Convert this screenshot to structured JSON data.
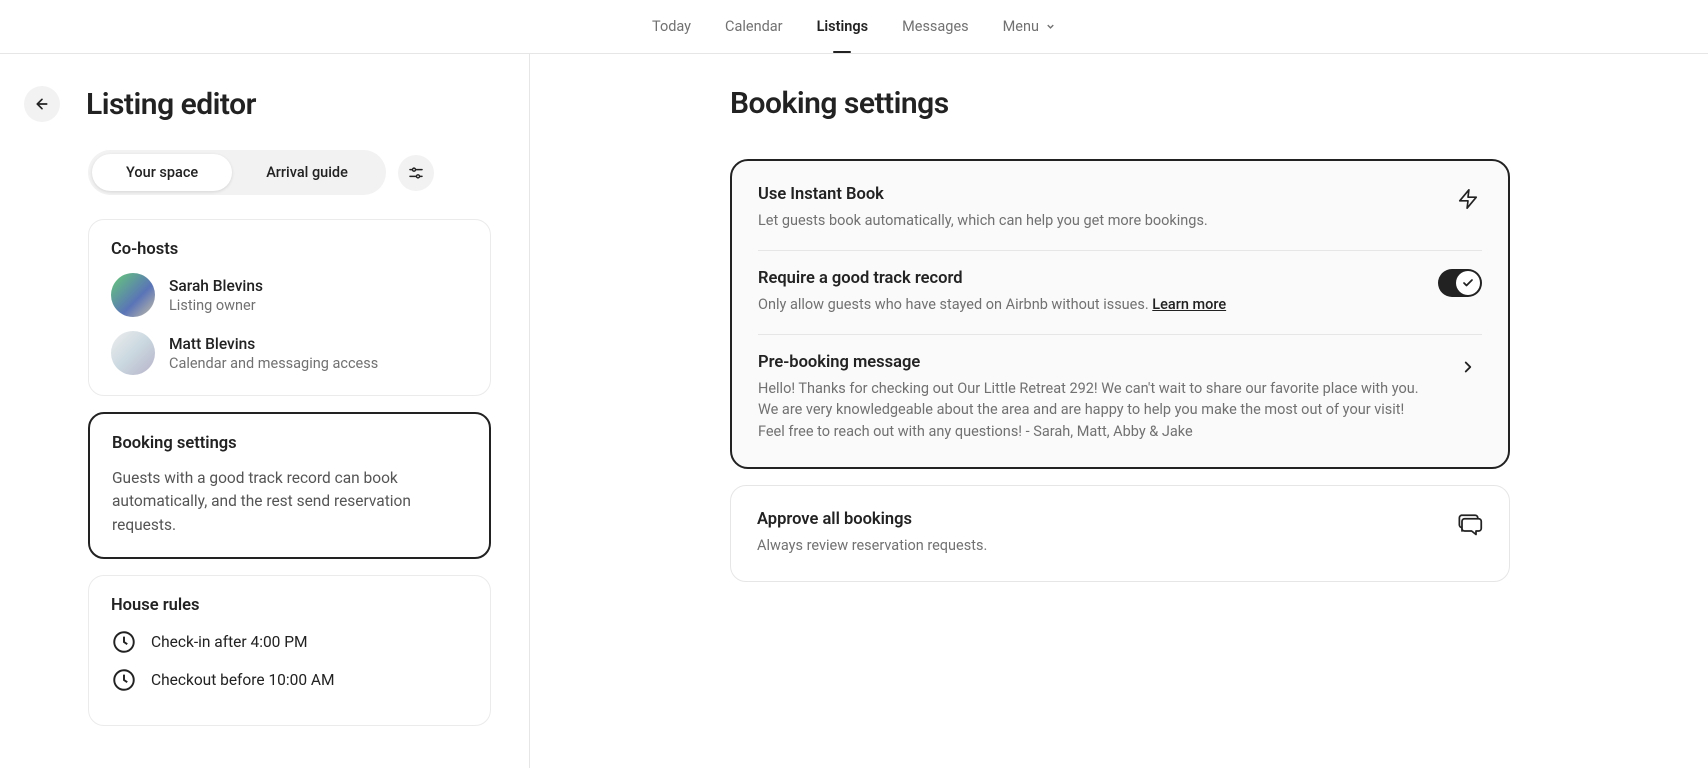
{
  "nav": {
    "today": "Today",
    "calendar": "Calendar",
    "listings": "Listings",
    "messages": "Messages",
    "menu": "Menu"
  },
  "left": {
    "title": "Listing editor",
    "tabs": {
      "your_space": "Your space",
      "arrival_guide": "Arrival guide"
    },
    "cohosts": {
      "title": "Co-hosts",
      "items": [
        {
          "name": "Sarah Blevins",
          "role": "Listing owner"
        },
        {
          "name": "Matt Blevins",
          "role": "Calendar and messaging access"
        }
      ]
    },
    "booking_card": {
      "title": "Booking settings",
      "desc": "Guests with a good track record can book automatically, and the rest send reservation requests."
    },
    "house_rules": {
      "title": "House rules",
      "checkin": "Check-in after 4:00 PM",
      "checkout": "Checkout before 10:00 AM"
    }
  },
  "right": {
    "title": "Booking settings",
    "instant": {
      "title": "Use Instant Book",
      "desc": "Let guests book automatically, which can help you get more bookings."
    },
    "track_record": {
      "title": "Require a good track record",
      "desc_prefix": "Only allow guests who have stayed on Airbnb without issues. ",
      "learn_more": "Learn more",
      "toggle_on": true
    },
    "prebooking": {
      "title": "Pre-booking message",
      "desc": "Hello! Thanks for checking out Our Little Retreat 292! We can't wait to share our favorite place with you. We are very knowledgeable about the area and are happy to help you make the most out of your visit! Feel free to reach out with any questions! - Sarah, Matt, Abby & Jake"
    },
    "approve": {
      "title": "Approve all bookings",
      "desc": "Always review reservation requests."
    }
  }
}
